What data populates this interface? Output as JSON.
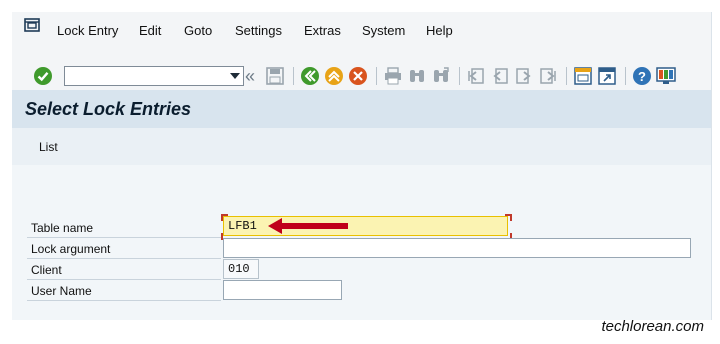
{
  "menu": {
    "items": [
      "Lock Entry",
      "Edit",
      "Goto",
      "Settings",
      "Extras",
      "System",
      "Help"
    ]
  },
  "toolbar": {
    "command_value": "",
    "icons": [
      "enter-icon",
      "back-double-icon",
      "save-icon",
      "back-icon",
      "exit-icon",
      "cancel-icon",
      "print-icon",
      "find-icon",
      "find-next-icon",
      "first-page-icon",
      "previous-page-icon",
      "next-page-icon",
      "last-page-icon",
      "create-session-icon",
      "shortcut-icon",
      "help-icon",
      "customize-layout-icon"
    ]
  },
  "screen": {
    "title": "Select Lock Entries",
    "app_toolbar_item": "List"
  },
  "form": {
    "table_name_label": "Table name",
    "table_name_value": "LFB1",
    "lock_argument_label": "Lock argument",
    "lock_argument_value": "",
    "client_label": "Client",
    "client_value": "010",
    "user_name_label": "User Name",
    "user_name_value": ""
  },
  "watermark": "techlorean.com",
  "colors": {
    "required_field": "#fbf3b2",
    "arrow": "#c0001a",
    "title_bg": "#d8e4ee"
  }
}
